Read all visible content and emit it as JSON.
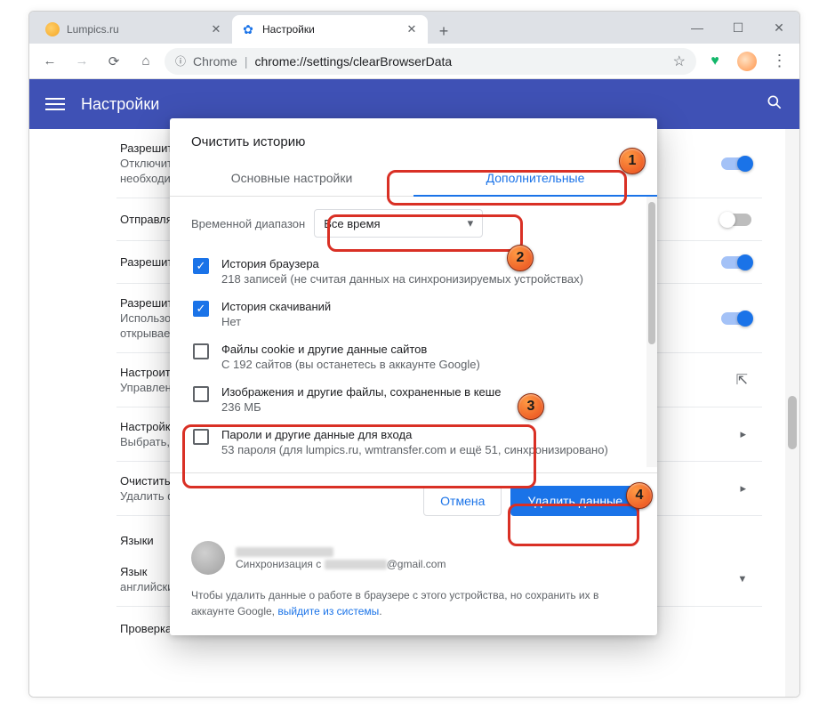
{
  "window": {
    "tabs": [
      {
        "title": "Lumpics.ru"
      },
      {
        "title": "Настройки"
      }
    ],
    "minimize": "—",
    "maximize": "☐",
    "close": "✕"
  },
  "toolbar": {
    "chrome_label": "Chrome",
    "url_path": "chrome://settings/clearBrowserData"
  },
  "settings_header": {
    "title": "Настройки"
  },
  "bg_rows": [
    {
      "label": "Разрешит",
      "sub": "Отключить",
      "sub2": "необходим",
      "toggle": "on"
    },
    {
      "label": "Отправлят",
      "sub": "",
      "toggle": "off"
    },
    {
      "label": "Разрешить",
      "sub": "",
      "toggle": "on"
    },
    {
      "label": "Разрешит",
      "sub": "Использов",
      "sub2": "открывает",
      "toggle": "on"
    },
    {
      "label": "Настроить",
      "sub": "Управлени",
      "icon": "ext"
    },
    {
      "label": "Настройки",
      "sub": "Выбрать,",
      "icon": "arrow"
    },
    {
      "label": "Очистить",
      "sub": "Удалить ф",
      "icon": "arrow"
    }
  ],
  "languages": {
    "section": "Языки",
    "row1_label": "Язык",
    "row1_sub": "английски",
    "row2_label": "Проверка правописания"
  },
  "modal": {
    "title": "Очистить историю",
    "tabs": {
      "basic": "Основные настройки",
      "advanced": "Дополнительные"
    },
    "time_label": "Временной диапазон",
    "time_value": "Все время",
    "items": [
      {
        "checked": true,
        "title": "История браузера",
        "desc": "218 записей (не считая данных на синхронизируемых устройствах)"
      },
      {
        "checked": true,
        "title": "История скачиваний",
        "desc": "Нет"
      },
      {
        "checked": false,
        "title": "Файлы cookie и другие данные сайтов",
        "desc": "С 192 сайтов (вы останетесь в аккаунте Google)"
      },
      {
        "checked": false,
        "title": "Изображения и другие файлы, сохраненные в кеше",
        "desc": "236 МБ"
      },
      {
        "checked": false,
        "title": "Пароли и другие данные для входа",
        "desc": "53 пароля (для lumpics.ru, wmtransfer.com и ещё 51, синхронизировано)"
      }
    ],
    "cancel": "Отмена",
    "confirm": "Удалить данные",
    "sync_prefix": "Синхронизация с",
    "sync_email_suffix": "@gmail.com",
    "footnote_a": "Чтобы удалить данные о работе в браузере с этого устройства, но сохранить их в аккаунте Google, ",
    "footnote_link": "выйдите из системы",
    "footnote_b": "."
  },
  "markers": {
    "m1": "1",
    "m2": "2",
    "m3": "3",
    "m4": "4"
  }
}
